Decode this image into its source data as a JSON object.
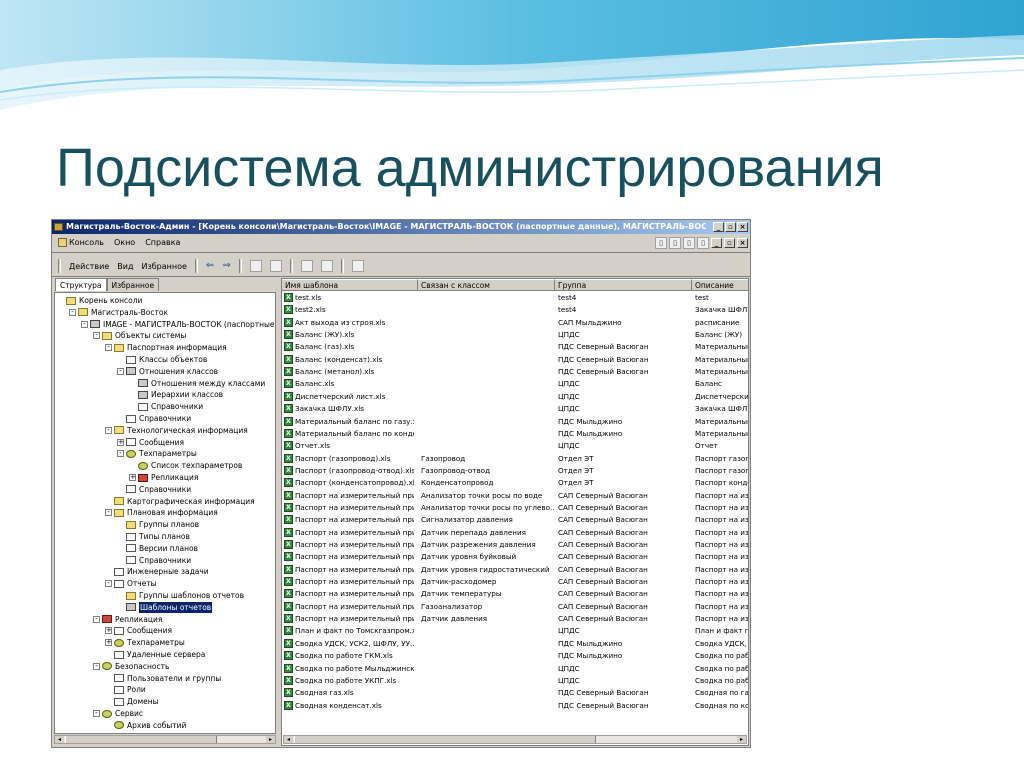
{
  "slide": {
    "title": "Подсистема администрирования"
  },
  "window": {
    "title": "Магистраль-Восток-Админ - [Корень консоли\\Магистраль-Восток\\IMAGE - МАГИСТРАЛЬ-ВОСТОК (паспортные данные), МАГИСТРАЛЬ-ВОСТОК (технологически...",
    "caption_buttons": [
      "_",
      "▫",
      "×"
    ]
  },
  "menubar": {
    "items": [
      "Консоль",
      "Окно",
      "Справка"
    ],
    "right_buttons": [
      "▯",
      "▯",
      "▯",
      "▯"
    ],
    "mdi_buttons": [
      "_",
      "▫",
      "×"
    ]
  },
  "toolbar": {
    "items": [
      "Действие",
      "Вид",
      "Избранное"
    ],
    "back": "⇐",
    "forward": "⇒"
  },
  "tabs": [
    "Структура",
    "Избранное"
  ],
  "tree": [
    {
      "label": "Корень консоли",
      "level": 0,
      "toggle": "",
      "icon": "folder",
      "selected": false
    },
    {
      "label": "Магистраль-Восток",
      "level": 1,
      "toggle": "-",
      "icon": "folder",
      "selected": false
    },
    {
      "label": "IMAGE - МАГИСТРАЛЬ-ВОСТОК (паспортные данные)",
      "level": 2,
      "toggle": "-",
      "icon": "cube",
      "selected": false
    },
    {
      "label": "Объекты системы",
      "level": 3,
      "toggle": "-",
      "icon": "folder",
      "selected": false
    },
    {
      "label": "Паспортная информация",
      "level": 4,
      "toggle": "-",
      "icon": "folder",
      "selected": false
    },
    {
      "label": "Классы объектов",
      "level": 5,
      "toggle": "",
      "icon": "doc",
      "selected": false
    },
    {
      "label": "Отношения классов",
      "level": 5,
      "toggle": "-",
      "icon": "cube",
      "selected": false
    },
    {
      "label": "Отношения между классами",
      "level": 6,
      "toggle": "",
      "icon": "cube",
      "selected": false
    },
    {
      "label": "Иерархии классов",
      "level": 6,
      "toggle": "",
      "icon": "cube",
      "selected": false
    },
    {
      "label": "Справочники",
      "level": 6,
      "toggle": "",
      "icon": "doc",
      "selected": false
    },
    {
      "label": "Справочники",
      "level": 5,
      "toggle": "",
      "icon": "doc",
      "selected": false
    },
    {
      "label": "Технологическая информация",
      "level": 4,
      "toggle": "-",
      "icon": "folder",
      "selected": false
    },
    {
      "label": "Сообщения",
      "level": 5,
      "toggle": "+",
      "icon": "doc",
      "selected": false
    },
    {
      "label": "Техпараметры",
      "level": 5,
      "toggle": "-",
      "icon": "gear",
      "selected": false
    },
    {
      "label": "Список техпараметров",
      "level": 6,
      "toggle": "",
      "icon": "gear",
      "selected": false
    },
    {
      "label": "Репликация",
      "level": 6,
      "toggle": "+",
      "icon": "red",
      "selected": false
    },
    {
      "label": "Справочники",
      "level": 5,
      "toggle": "",
      "icon": "doc",
      "selected": false
    },
    {
      "label": "Картографическая информация",
      "level": 4,
      "toggle": "",
      "icon": "folder",
      "selected": false
    },
    {
      "label": "Плановая информация",
      "level": 4,
      "toggle": "-",
      "icon": "folder",
      "selected": false
    },
    {
      "label": "Группы планов",
      "level": 5,
      "toggle": "",
      "icon": "folder",
      "selected": false
    },
    {
      "label": "Типы планов",
      "level": 5,
      "toggle": "",
      "icon": "doc",
      "selected": false
    },
    {
      "label": "Версии планов",
      "level": 5,
      "toggle": "",
      "icon": "doc",
      "selected": false
    },
    {
      "label": "Справочники",
      "level": 5,
      "toggle": "",
      "icon": "doc",
      "selected": false
    },
    {
      "label": "Инженерные задачи",
      "level": 4,
      "toggle": "",
      "icon": "doc",
      "selected": false
    },
    {
      "label": "Отчеты",
      "level": 4,
      "toggle": "-",
      "icon": "doc",
      "selected": false
    },
    {
      "label": "Группы шаблонов отчетов",
      "level": 5,
      "toggle": "",
      "icon": "folder",
      "selected": false
    },
    {
      "label": "Шаблоны отчетов",
      "level": 5,
      "toggle": "",
      "icon": "cube",
      "selected": true
    },
    {
      "label": "Репликация",
      "level": 3,
      "toggle": "-",
      "icon": "red",
      "selected": false
    },
    {
      "label": "Сообщения",
      "level": 4,
      "toggle": "+",
      "icon": "doc",
      "selected": false
    },
    {
      "label": "Техпараметры",
      "level": 4,
      "toggle": "+",
      "icon": "gear",
      "selected": false
    },
    {
      "label": "Удаленные сервера",
      "level": 4,
      "toggle": "",
      "icon": "doc",
      "selected": false
    },
    {
      "label": "Безопасность",
      "level": 3,
      "toggle": "-",
      "icon": "gear",
      "selected": false
    },
    {
      "label": "Пользователи и группы",
      "level": 4,
      "toggle": "",
      "icon": "doc",
      "selected": false
    },
    {
      "label": "Роли",
      "level": 4,
      "toggle": "",
      "icon": "doc",
      "selected": false
    },
    {
      "label": "Домены",
      "level": 4,
      "toggle": "",
      "icon": "doc",
      "selected": false
    },
    {
      "label": "Сервис",
      "level": 3,
      "toggle": "-",
      "icon": "gear",
      "selected": false
    },
    {
      "label": "Архив событий",
      "level": 4,
      "toggle": "",
      "icon": "gear",
      "selected": false
    }
  ],
  "list": {
    "columns": [
      "Имя шаблона",
      "Связан с классом",
      "Группа",
      "Описание"
    ],
    "rows": [
      [
        "test.xls",
        "",
        "test4",
        "test"
      ],
      [
        "test2.xls",
        "",
        "test4",
        "Закачка ШФЛУ"
      ],
      [
        "Акт выхода из строя.xls",
        "",
        "САП Мыльджино",
        "расписание"
      ],
      [
        "Баланс (ЖУ).xls",
        "",
        "ЦПДС",
        "Баланс (ЖУ)"
      ],
      [
        "Баланс (газ).xls",
        "",
        "ПДС Северный Васюган",
        "Материальный б"
      ],
      [
        "Баланс (конденсат).xls",
        "",
        "ПДС Северный Васюган",
        "Материальный б"
      ],
      [
        "Баланс (метанол).xls",
        "",
        "ПДС Северный Васюган",
        "Материальный б"
      ],
      [
        "Баланс.xls",
        "",
        "ЦПДС",
        "Баланс"
      ],
      [
        "Диспетчерский лист.xls",
        "",
        "ЦПДС",
        "Диспетчерский"
      ],
      [
        "Закачка ШФЛУ.xls",
        "",
        "ЦПДС",
        "Закачка ШФЛУ"
      ],
      [
        "Материальный баланс по газу.xls",
        "",
        "ПДС Мыльджино",
        "Материальный б"
      ],
      [
        "Материальный баланс по конде...",
        "",
        "ПДС Мыльджино",
        "Материальный б"
      ],
      [
        "Отчет.xls",
        "",
        "ЦПДС",
        "Отчет"
      ],
      [
        "Паспорт (газопровод).xls",
        "Газопровод",
        "Отдел ЭТ",
        "Паспорт газопр"
      ],
      [
        "Паспорт (газопровод-отвод).xls",
        "Газопровод-отвод",
        "Отдел ЭТ",
        "Паспорт газопр"
      ],
      [
        "Паспорт (конденсатопровод).xls",
        "Конденсатопровод",
        "Отдел ЭТ",
        "Паспорт конден"
      ],
      [
        "Паспорт на измерительный приб...",
        "Анализатор точки росы по воде",
        "САП Северный Васюган",
        "Паспорт на изме"
      ],
      [
        "Паспорт на измерительный приб...",
        "Анализатор точки росы по углево...",
        "САП Северный Васюган",
        "Паспорт на изме"
      ],
      [
        "Паспорт на измерительный приб...",
        "Сигнализатор давления",
        "САП Северный Васюган",
        "Паспорт на изме"
      ],
      [
        "Паспорт на измерительный приб...",
        "Датчик перепада давления",
        "САП Северный Васюган",
        "Паспорт на изме"
      ],
      [
        "Паспорт на измерительный приб...",
        "Датчик разрежения давления",
        "САП Северный Васюган",
        "Паспорт на изме"
      ],
      [
        "Паспорт на измерительный приб...",
        "Датчик уровня буйковый",
        "САП Северный Васюган",
        "Паспорт на изме"
      ],
      [
        "Паспорт на измерительный приб...",
        "Датчик уровня гидростатический",
        "САП Северный Васюган",
        "Паспорт на изме"
      ],
      [
        "Паспорт на измерительный приб...",
        "Датчик-расходомер",
        "САП Северный Васюган",
        "Паспорт на изме"
      ],
      [
        "Паспорт на измерительный приб...",
        "Датчик температуры",
        "САП Северный Васюган",
        "Паспорт на изме"
      ],
      [
        "Паспорт на измерительный приб...",
        "Газоанализатор",
        "САП Северный Васюган",
        "Паспорт на изме"
      ],
      [
        "Паспорт на измерительный приб...",
        "Датчик давления",
        "САП Северный Васюган",
        "Паспорт на изме"
      ],
      [
        "План и факт по Томскгазпром.xls",
        "",
        "ЦПДС",
        "План и факт по"
      ],
      [
        "Сводка УДСК, УСК2, ШФЛУ, УУ...",
        "",
        "ПДС Мыльджино",
        "Сводка УДСК, У"
      ],
      [
        "Сводка по работе ГКМ.xls",
        "",
        "ПДС Мыльджино",
        "Сводка по рабо"
      ],
      [
        "Сводка по работе Мыльджинск...",
        "",
        "ЦПДС",
        "Сводка по рабо"
      ],
      [
        "Сводка по работе УКПГ.xls",
        "",
        "ЦПДС",
        "Сводка по рабо"
      ],
      [
        "Сводная газ.xls",
        "",
        "ПДС Северный Васюган",
        "Сводная по газу"
      ],
      [
        "Сводная конденсат.xls",
        "",
        "ПДС Северный Васюган",
        "Сводная по кон"
      ]
    ]
  },
  "colors": {
    "title_text": "#17505e",
    "titlebar_start": "#0a246a",
    "titlebar_end": "#a6caf0",
    "window_bg": "#d4d0c8",
    "wave_light": "#d8eef8",
    "wave_mid": "#8fd0e8",
    "wave_dark": "#3aa9d4"
  }
}
